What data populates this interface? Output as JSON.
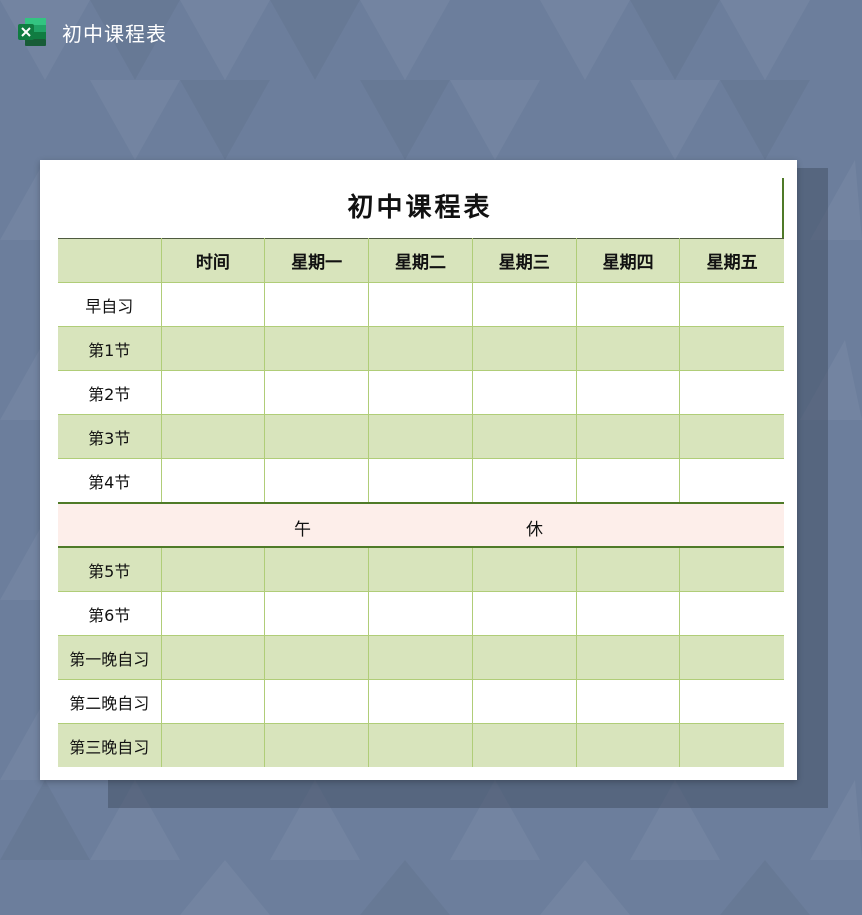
{
  "app": {
    "icon": "excel-icon",
    "title": "初中课程表"
  },
  "sheet": {
    "title": "初中课程表",
    "header": [
      "",
      "时间",
      "星期一",
      "星期二",
      "星期三",
      "星期四",
      "星期五"
    ],
    "rows_before_lunch": [
      {
        "label": "早自习",
        "style": "white"
      },
      {
        "label": "第1节",
        "style": "green"
      },
      {
        "label": "第2节",
        "style": "white"
      },
      {
        "label": "第3节",
        "style": "green"
      },
      {
        "label": "第4节",
        "style": "white"
      }
    ],
    "lunch": {
      "left": "午",
      "right": "休"
    },
    "rows_after_lunch": [
      {
        "label": "第5节",
        "style": "green"
      },
      {
        "label": "第6节",
        "style": "white"
      },
      {
        "label": "第一晚自习",
        "style": "green"
      },
      {
        "label": "第二晚自习",
        "style": "white"
      },
      {
        "label": "第三晚自习",
        "style": "green"
      }
    ]
  },
  "colors": {
    "background": "#6c7e9c",
    "header_fill": "#d8e4bc",
    "row_green": "#d8e4bc",
    "row_white": "#ffffff",
    "lunch_fill": "#fdeeea",
    "grid_line": "#b0cd78",
    "excel_green": "#1f7346"
  }
}
